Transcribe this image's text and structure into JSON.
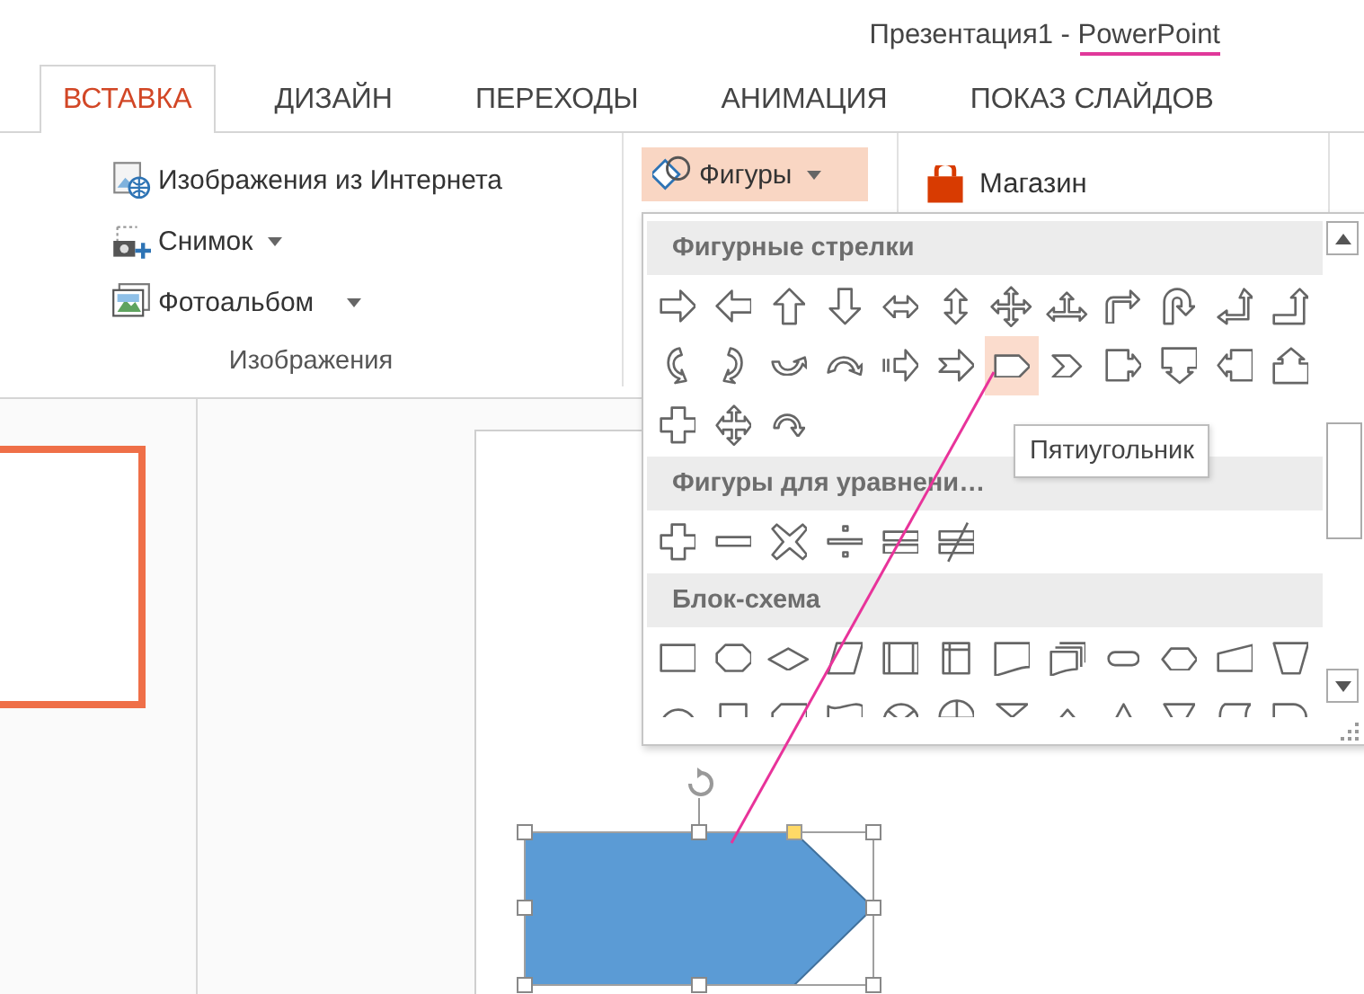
{
  "window": {
    "title": "Презентация1 - PowerPoint"
  },
  "tabs": [
    {
      "label": "ВСТАВКА",
      "selected": true
    },
    {
      "label": "ДИЗАЙН",
      "selected": false
    },
    {
      "label": "ПЕРЕХОДЫ",
      "selected": false
    },
    {
      "label": "АНИМАЦИЯ",
      "selected": false
    },
    {
      "label": "ПОКАЗ СЛАЙДОВ",
      "selected": false
    }
  ],
  "ribbon": {
    "images_group": {
      "label": "Изображения",
      "items": [
        {
          "label": "Изображения из Интернета",
          "dropdown": false
        },
        {
          "label": "Снимок",
          "dropdown": true
        },
        {
          "label": "Фотоальбом",
          "dropdown": true
        }
      ]
    },
    "shapes_button": {
      "label": "Фигуры",
      "pressed": true
    },
    "store_button": {
      "label": "Магазин"
    }
  },
  "gallery": {
    "sections": [
      {
        "title": "Фигурные стрелки",
        "items": [
          {
            "selected": false
          },
          {
            "selected": false
          },
          {
            "selected": false
          },
          {
            "selected": false
          },
          {
            "selected": false
          },
          {
            "selected": false
          },
          {
            "selected": false
          },
          {
            "selected": false
          },
          {
            "selected": false
          },
          {
            "selected": false
          },
          {
            "selected": false
          },
          {
            "selected": false
          },
          {
            "selected": false
          },
          {
            "selected": false
          },
          {
            "selected": false
          },
          {
            "selected": false
          },
          {
            "selected": false
          },
          {
            "selected": false
          },
          {
            "selected": true
          },
          {
            "selected": false
          },
          {
            "selected": false
          },
          {
            "selected": false
          },
          {
            "selected": false
          },
          {
            "selected": false
          },
          {
            "selected": false
          },
          {
            "selected": false
          },
          {
            "selected": false
          }
        ]
      },
      {
        "title": "Фигуры для уравнени…",
        "items": [
          {
            "selected": false
          },
          {
            "selected": false
          },
          {
            "selected": false
          },
          {
            "selected": false
          },
          {
            "selected": false
          },
          {
            "selected": false
          }
        ]
      },
      {
        "title": "Блок-схема",
        "items": [
          {
            "selected": false
          },
          {
            "selected": false
          },
          {
            "selected": false
          },
          {
            "selected": false
          },
          {
            "selected": false
          },
          {
            "selected": false
          },
          {
            "selected": false
          },
          {
            "selected": false
          },
          {
            "selected": false
          },
          {
            "selected": false
          },
          {
            "selected": false
          },
          {
            "selected": false
          },
          {
            "selected": false
          },
          {
            "selected": false
          },
          {
            "selected": false
          },
          {
            "selected": false
          },
          {
            "selected": false
          },
          {
            "selected": false
          },
          {
            "selected": false
          },
          {
            "selected": false
          },
          {
            "selected": false
          },
          {
            "selected": false
          },
          {
            "selected": false
          },
          {
            "selected": false
          }
        ]
      }
    ]
  },
  "tooltip": {
    "text": "Пятиугольник"
  }
}
